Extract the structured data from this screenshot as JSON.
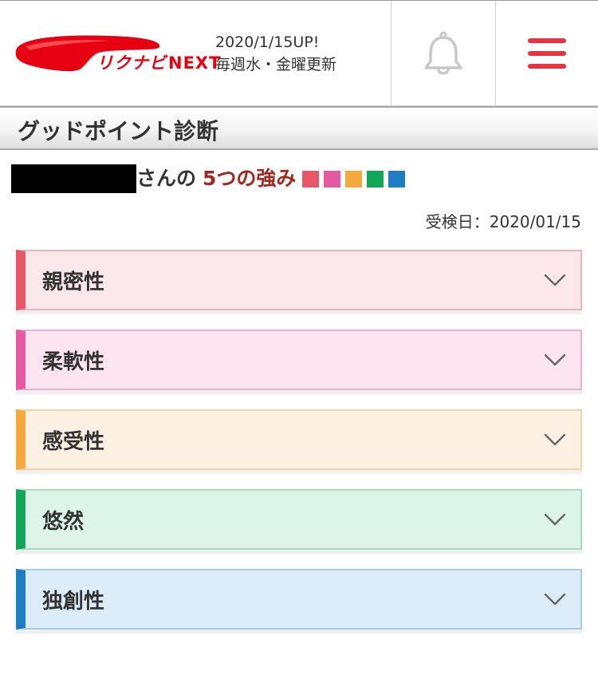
{
  "header": {
    "logo": {
      "kana": "リクナビ",
      "next": "NEXT"
    },
    "update_date": "2020/1/15UP!",
    "update_schedule": "毎週水・金曜更新",
    "icons": {
      "notification": "bell-icon",
      "menu": "hamburger-menu-icon"
    }
  },
  "page": {
    "title": "グッドポイント診断"
  },
  "result": {
    "user_suffix": "さんの",
    "strengths_title": "5つの強み",
    "exam_date": "受検日：2020/01/15",
    "swatch_colors": [
      "#e8566a",
      "#e55aa0",
      "#f3a93b",
      "#12a65b",
      "#1f7dc4"
    ]
  },
  "strengths": [
    {
      "label": "親密性",
      "accent": "#e8566a",
      "bg": "#fce8ea",
      "border": "#efb4bb"
    },
    {
      "label": "柔軟性",
      "accent": "#e55aa0",
      "bg": "#fce4f0",
      "border": "#efb0d0"
    },
    {
      "label": "感受性",
      "accent": "#f3a93b",
      "bg": "#fdf1e3",
      "border": "#f4d3a6"
    },
    {
      "label": "悠然",
      "accent": "#12a65b",
      "bg": "#dcf5e8",
      "border": "#a6dcc0"
    },
    {
      "label": "独創性",
      "accent": "#1f7dc4",
      "bg": "#dcecf8",
      "border": "#a8cde9"
    }
  ],
  "icons": {
    "expand": "chevron-down-icon"
  }
}
